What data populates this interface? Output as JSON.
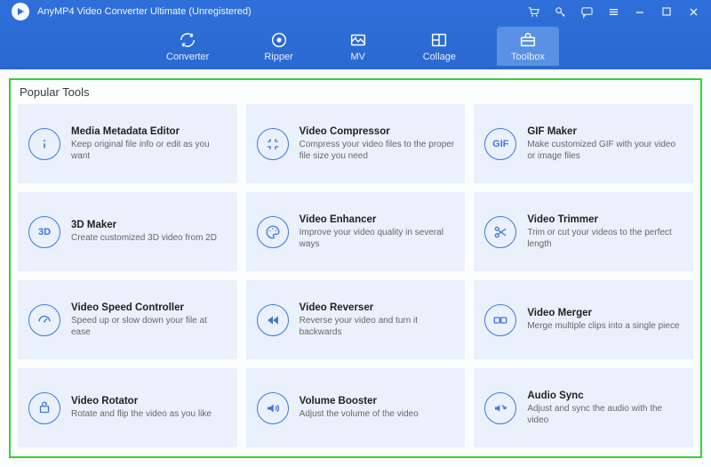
{
  "app": {
    "title": "AnyMP4 Video Converter Ultimate (Unregistered)"
  },
  "title_icons": {
    "cart": "cart-icon",
    "key": "key-icon",
    "chat": "chat-icon",
    "menu": "menu-icon",
    "minimize": "minimize-icon",
    "maximize": "maximize-icon",
    "close": "close-icon"
  },
  "tabs": [
    {
      "id": "converter",
      "label": "Converter",
      "active": false
    },
    {
      "id": "ripper",
      "label": "Ripper",
      "active": false
    },
    {
      "id": "mv",
      "label": "MV",
      "active": false
    },
    {
      "id": "collage",
      "label": "Collage",
      "active": false
    },
    {
      "id": "toolbox",
      "label": "Toolbox",
      "active": true
    }
  ],
  "panel": {
    "heading": "Popular Tools"
  },
  "tools": [
    {
      "id": "media-metadata-editor",
      "icon": "info-icon",
      "title": "Media Metadata Editor",
      "desc": "Keep original file info or edit as you want"
    },
    {
      "id": "video-compressor",
      "icon": "compress-icon",
      "title": "Video Compressor",
      "desc": "Compress your video files to the proper file size you need"
    },
    {
      "id": "gif-maker",
      "icon": "gif-icon",
      "title": "GIF Maker",
      "desc": "Make customized GIF with your video or image files"
    },
    {
      "id": "3d-maker",
      "icon": "3d-icon",
      "title": "3D Maker",
      "desc": "Create customized 3D video from 2D"
    },
    {
      "id": "video-enhancer",
      "icon": "palette-icon",
      "title": "Video Enhancer",
      "desc": "Improve your video quality in several ways"
    },
    {
      "id": "video-trimmer",
      "icon": "scissors-icon",
      "title": "Video Trimmer",
      "desc": "Trim or cut your videos to the perfect length"
    },
    {
      "id": "video-speed-controller",
      "icon": "speed-icon",
      "title": "Video Speed Controller",
      "desc": "Speed up or slow down your file at ease"
    },
    {
      "id": "video-reverser",
      "icon": "rewind-icon",
      "title": "Video Reverser",
      "desc": "Reverse your video and turn it backwards"
    },
    {
      "id": "video-merger",
      "icon": "merge-icon",
      "title": "Video Merger",
      "desc": "Merge multiple clips into a single piece"
    },
    {
      "id": "video-rotator",
      "icon": "rotate-icon",
      "title": "Video Rotator",
      "desc": "Rotate and flip the video as you like"
    },
    {
      "id": "volume-booster",
      "icon": "volume-icon",
      "title": "Volume Booster",
      "desc": "Adjust the volume of the video"
    },
    {
      "id": "audio-sync",
      "icon": "sync-icon",
      "title": "Audio Sync",
      "desc": "Adjust and sync the audio with the video"
    }
  ]
}
